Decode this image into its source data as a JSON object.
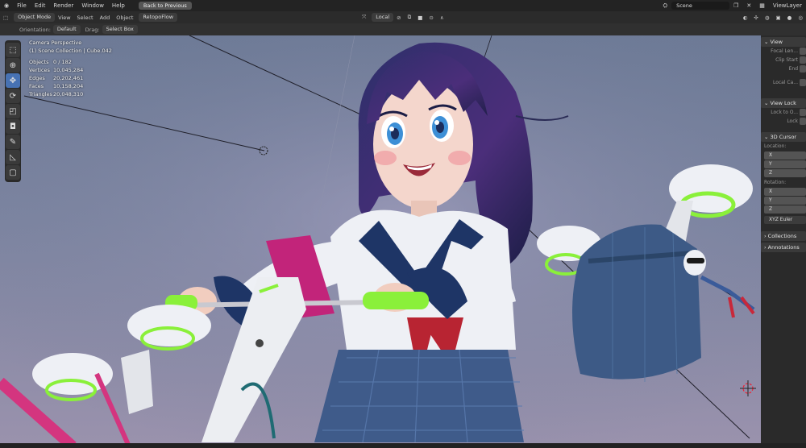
{
  "topbar": {
    "menus": [
      "File",
      "Edit",
      "Render",
      "Window",
      "Help"
    ],
    "back_label": "Back to Previous",
    "scene_value": "Scene",
    "view_layer": "ViewLayer"
  },
  "header": {
    "mode": "Object Mode",
    "menus": [
      "View",
      "Select",
      "Add",
      "Object"
    ],
    "retopoflow": "RetopoFlow",
    "transform_orientation": "Local"
  },
  "toolsettings": {
    "orientation_label": "Orientation:",
    "orientation_value": "Default",
    "drag_label": "Drag:",
    "drag_value": "Select Box"
  },
  "overlay": {
    "camera": "Camera Perspective",
    "collection": "(1) Scene Collection | Cube.042",
    "stats": [
      {
        "label": "Objects",
        "value": "0 / 182"
      },
      {
        "label": "Vertices",
        "value": "10,045,284"
      },
      {
        "label": "Edges",
        "value": "20,202,461"
      },
      {
        "label": "Faces",
        "value": "10,158,204"
      },
      {
        "label": "Triangles",
        "value": "20,048,310"
      }
    ]
  },
  "npanel": {
    "view_header": "View",
    "focal_length": "Focal Len...",
    "clip_start": "Clip Start",
    "clip_end": "End",
    "local_camera": "Local Ca...",
    "view_lock_header": "View Lock",
    "lock_to_object": "Lock to O...",
    "lock": "Lock",
    "cursor_header": "3D Cursor",
    "location_label": "Location:",
    "loc_axes": [
      "X",
      "Y",
      "Z"
    ],
    "rotation_label": "Rotation:",
    "rot_axes": [
      "X",
      "Y",
      "Z"
    ],
    "rotation_mode": "XYZ Euler",
    "collections_header": "Collections",
    "annotations_header": "Annotations"
  },
  "colors": {
    "active_tool": "#4772b3",
    "accent_green": "#8af03a",
    "hair": "#2b2f6e"
  }
}
